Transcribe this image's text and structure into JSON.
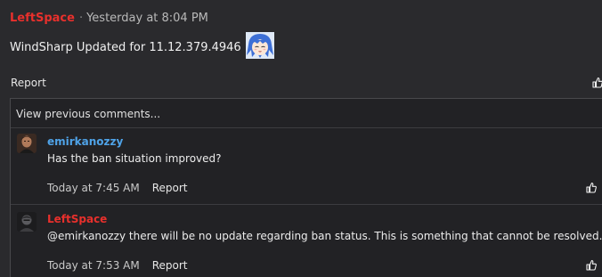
{
  "post": {
    "author": "LeftSpace",
    "separator": "·",
    "timestamp": "Yesterday at 8:04 PM",
    "body": "WindSharp Updated for 11.12.379.4946",
    "report_label": "Report",
    "like_icon": "thumbs-up-icon"
  },
  "comments_section": {
    "view_previous_label": "View previous comments..."
  },
  "comments": [
    {
      "author": "emirkanozzy",
      "text": "Has the ban situation improved?",
      "time": "Today at 7:45 AM",
      "report_label": "Report"
    },
    {
      "author": "LeftSpace",
      "text": "@emirkanozzy there will be no update regarding ban status. This is something that cannot be resolved.",
      "time": "Today at 7:53 AM",
      "report_label": "Report"
    }
  ],
  "colors": {
    "background": "#2a2a2d",
    "author_red": "#e8302c",
    "author_blue": "#4fa3e8"
  }
}
